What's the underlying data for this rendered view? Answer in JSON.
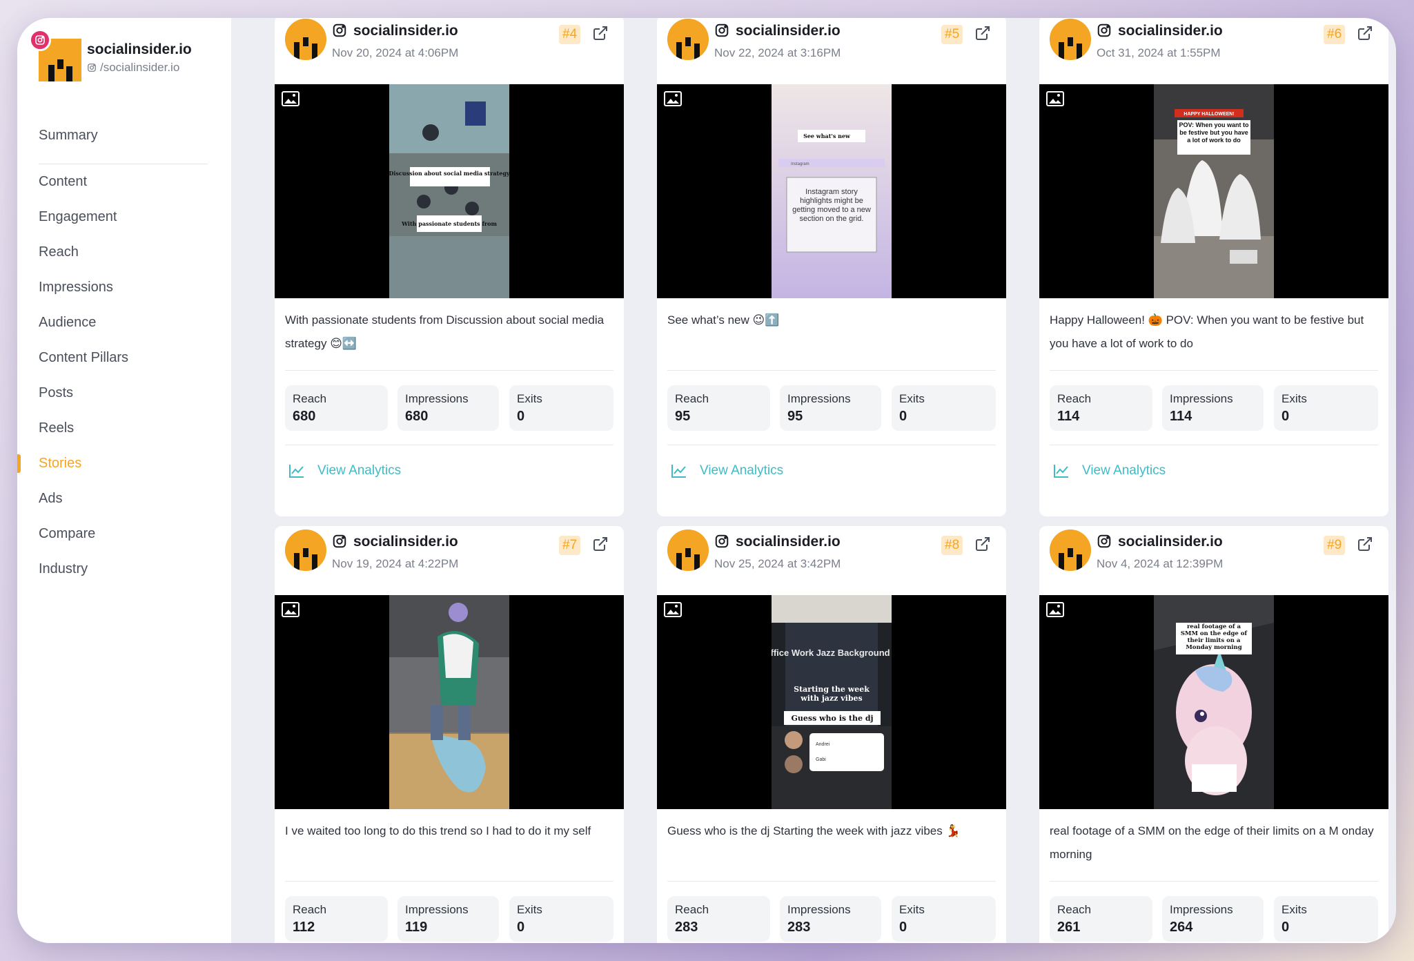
{
  "profile": {
    "name": "socialinsider.io",
    "handle": "/socialinsider.io"
  },
  "nav": [
    {
      "label": "Summary"
    },
    {
      "label": "Content"
    },
    {
      "label": "Engagement"
    },
    {
      "label": "Reach"
    },
    {
      "label": "Impressions"
    },
    {
      "label": "Audience"
    },
    {
      "label": "Content Pillars"
    },
    {
      "label": "Posts"
    },
    {
      "label": "Reels"
    },
    {
      "label": "Stories",
      "active": true
    },
    {
      "label": "Ads"
    },
    {
      "label": "Compare"
    },
    {
      "label": "Industry"
    }
  ],
  "stat_labels": {
    "reach": "Reach",
    "impressions": "Impressions",
    "exits": "Exits"
  },
  "view_analytics_label": "View Analytics",
  "colors": {
    "accent": "#f5a524",
    "teal": "#3ebcc4",
    "instagram": "#e1306c"
  },
  "cards": [
    {
      "account": "socialinsider.io",
      "date": "Nov 20, 2024 at 4:06PM",
      "rank": "#4",
      "caption": "With passionate students from Discussion about social media strategy 😊↔️",
      "reach": "680",
      "impressions": "680",
      "exits": "0"
    },
    {
      "account": "socialinsider.io",
      "date": "Nov 22, 2024 at 3:16PM",
      "rank": "#5",
      "caption": "See what’s new 😉⬆️",
      "reach": "95",
      "impressions": "95",
      "exits": "0"
    },
    {
      "account": "socialinsider.io",
      "date": "Oct 31, 2024 at 1:55PM",
      "rank": "#6",
      "caption": "Happy Halloween! 🎃 POV: When you want to be festive but you have a lot of work to do",
      "reach": "114",
      "impressions": "114",
      "exits": "0"
    },
    {
      "account": "socialinsider.io",
      "date": "Nov 19, 2024 at 4:22PM",
      "rank": "#7",
      "caption": "I ve waited too long to do this trend so I had to do it my self",
      "reach": "112",
      "impressions": "119",
      "exits": "0"
    },
    {
      "account": "socialinsider.io",
      "date": "Nov 25, 2024 at 3:42PM",
      "rank": "#8",
      "caption": "Guess who is the dj Starting the week with jazz vibes 💃",
      "reach": "283",
      "impressions": "283",
      "exits": "0"
    },
    {
      "account": "socialinsider.io",
      "date": "Nov 4, 2024 at 12:39PM",
      "rank": "#9",
      "caption": "real footage of a SMM on the edge of their limits on a M onday morning",
      "reach": "261",
      "impressions": "264",
      "exits": "0"
    }
  ],
  "thumb_text": {
    "t1a": "Discussion about social media strategy",
    "t1b": "With passionate students from",
    "t2a": "See what's new",
    "t2b": "Instagram story highlights might be getting moved to a new section on the grid.",
    "t2c": "Instagram",
    "t3a": "HAPPY HALLOWEEN!",
    "t3b": "POV: When you want to be festive but you have a lot of work to do",
    "t5a": "Office Work Jazz Background",
    "t5b": "Starting the week with jazz vibes",
    "t5c": "Guess who is the dj",
    "t5d": "Andrei",
    "t5e": "Gabi",
    "t6a": "real footage of a SMM on the edge of their limits on a Monday morning"
  }
}
